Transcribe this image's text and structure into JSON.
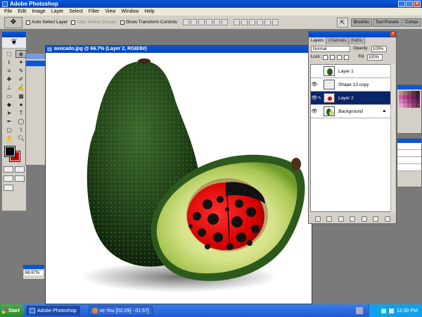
{
  "app": {
    "title": "Adobe Photoshop"
  },
  "menu": [
    "File",
    "Edit",
    "Image",
    "Layer",
    "Select",
    "Filter",
    "View",
    "Window",
    "Help"
  ],
  "options": {
    "auto_select_layer": "Auto Select Layer",
    "auto_select_groups": "Auto Select Groups",
    "show_transform_controls": "Show Transform Controls"
  },
  "well_tabs": [
    "Brushes",
    "Tool Presets",
    "Comps"
  ],
  "document": {
    "title": "avocado.jpg @ 66.7% (Layer 2, RGB/8#)"
  },
  "zoom": "66.67%",
  "layers": {
    "tabs": [
      "Layers",
      "Channels",
      "Paths"
    ],
    "blend_mode": "Normal",
    "opacity_label": "Opacity:",
    "opacity_value": "100%",
    "lock_label": "Lock:",
    "fill_label": "Fill:",
    "fill_value": "100%",
    "items": [
      {
        "name": "Layer 1",
        "visible": false,
        "selected": false
      },
      {
        "name": "Shape 13 copy",
        "visible": true,
        "selected": false
      },
      {
        "name": "Layer 2",
        "visible": true,
        "selected": true
      },
      {
        "name": "Background",
        "visible": true,
        "selected": false
      }
    ]
  },
  "taskbar": {
    "start": "Start",
    "tasks": [
      "Adobe Photoshop",
      "ve You [02:29] - 01:57]"
    ],
    "clock": "12:30 PM"
  },
  "colors": {
    "foreground": "#000000",
    "background": "#c00000",
    "accent": "#0a58d8"
  }
}
